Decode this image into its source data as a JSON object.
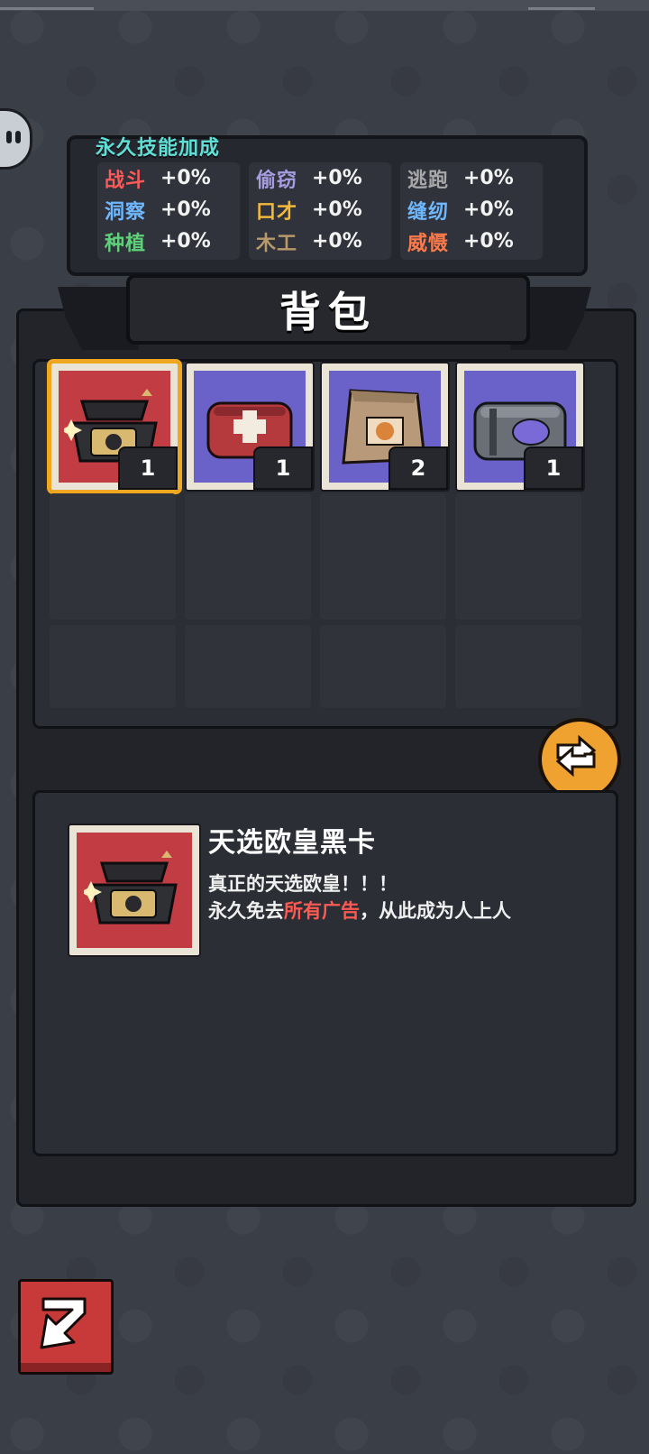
{
  "skills": {
    "title": "永久技能加成",
    "columns": [
      [
        {
          "name": "战斗",
          "value": "+0%",
          "color": "#ff5a5a"
        },
        {
          "name": "洞察",
          "value": "+0%",
          "color": "#6fb8ff"
        },
        {
          "name": "种植",
          "value": "+0%",
          "color": "#5fd07a"
        }
      ],
      [
        {
          "name": "偷窃",
          "value": "+0%",
          "color": "#a79ce0"
        },
        {
          "name": "口才",
          "value": "+0%",
          "color": "#f2b93a"
        },
        {
          "name": "木工",
          "value": "+0%",
          "color": "#b89a6a"
        }
      ],
      [
        {
          "name": "逃跑",
          "value": "+0%",
          "color": "#a8a8a8"
        },
        {
          "name": "缝纫",
          "value": "+0%",
          "color": "#6fb8ff"
        },
        {
          "name": "威慑",
          "value": "+0%",
          "color": "#ff7a4a"
        }
      ]
    ]
  },
  "backpack": {
    "title": "背包",
    "items": [
      {
        "icon": "black-card-gift-box-icon",
        "count": "1",
        "bg": "red",
        "selected": true
      },
      {
        "icon": "first-aid-kit-icon",
        "count": "1",
        "bg": "purple",
        "selected": false
      },
      {
        "icon": "paper-bag-cookie-icon",
        "count": "2",
        "bg": "purple",
        "selected": false
      },
      {
        "icon": "metal-lunchbox-icon",
        "count": "1",
        "bg": "purple",
        "selected": false
      }
    ]
  },
  "detail": {
    "name": "天选欧皇黑卡",
    "line1": "真正的天选欧皇！！！",
    "line2_a": "永久免去",
    "line2_b": "所有广告",
    "line2_c": "，从此成为人上人"
  },
  "icons": {
    "swap": "swap-arrows-icon",
    "back": "back-arrow-icon",
    "side": "chat-bubble-icon"
  }
}
